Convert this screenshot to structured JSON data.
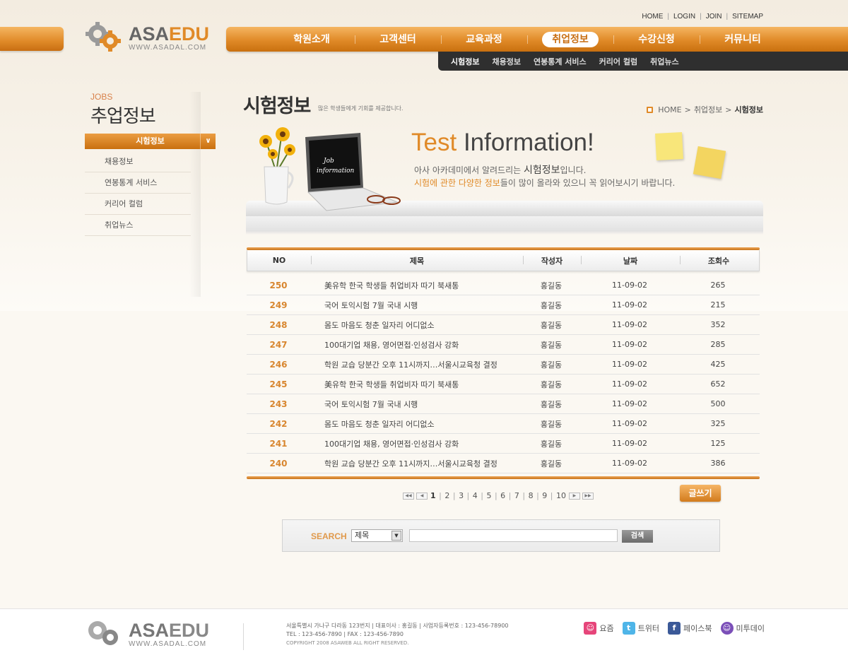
{
  "util_links": [
    "HOME",
    "LOGIN",
    "JOIN",
    "SITEMAP"
  ],
  "logo": {
    "name_gray": "ASA",
    "name_orange": "EDU",
    "url": "WWW.ASADAL.COM"
  },
  "gnb": [
    "학원소개",
    "고객센터",
    "교육과정",
    "취업정보",
    "수강신청",
    "커뮤니티"
  ],
  "sub_gnb": [
    "시험정보",
    "채용정보",
    "연봉통계 서비스",
    "커리어 컬럼",
    "취업뉴스"
  ],
  "lnb": {
    "title_en": "JOBS",
    "title": "추업정보",
    "active": "시험정보",
    "items": [
      "채용정보",
      "연봉통계 서비스",
      "커리어 컬럼",
      "취업뉴스"
    ]
  },
  "page": {
    "title": "시험정보",
    "desc": "많은 학생들에게 기회를 제공합니다.",
    "breadcrumb": [
      "HOME",
      "취업정보",
      "시험정보"
    ]
  },
  "banner": {
    "head_a": "Test",
    "head_b": "Information!",
    "line1_pre": "아사 아카데미에서 알려드리는 ",
    "line1_bold": "시험정보",
    "line1_post": "입니다.",
    "line2_bold": "시험에 관한 다양한 정보",
    "line2_post": "들이 많이 올라와 있으니 꼭 읽어보시기 바랍니다.",
    "laptop_text": "Job information"
  },
  "board": {
    "headers": {
      "no": "NO",
      "title": "제목",
      "author": "작성자",
      "date": "날짜",
      "views": "조회수"
    },
    "rows": [
      {
        "no": "250",
        "title": "美유학 한국 학생들 취업비자 따기 북새통",
        "author": "홍길동",
        "date": "11-09-02",
        "views": "265"
      },
      {
        "no": "249",
        "title": "국어 토익시험 7월 국내 시행",
        "author": "홍길동",
        "date": "11-09-02",
        "views": "215"
      },
      {
        "no": "248",
        "title": "몸도 마음도 청춘 일자리 어디없소",
        "author": "홍길동",
        "date": "11-09-02",
        "views": "352"
      },
      {
        "no": "247",
        "title": "100대기업 채용, 영어면접·인성검사 강화",
        "author": "홍길동",
        "date": "11-09-02",
        "views": "285"
      },
      {
        "no": "246",
        "title": "학원 교습 당분간 오후 11시까지…서울시교육청 결정",
        "author": "홍길동",
        "date": "11-09-02",
        "views": "425"
      },
      {
        "no": "245",
        "title": "美유학 한국 학생들 취업비자 따기 북새통",
        "author": "홍길동",
        "date": "11-09-02",
        "views": "652"
      },
      {
        "no": "243",
        "title": "국어 토익시험 7월 국내 시행",
        "author": "홍길동",
        "date": "11-09-02",
        "views": "500"
      },
      {
        "no": "242",
        "title": "몸도 마음도 청춘 일자리 어디없소",
        "author": "홍길동",
        "date": "11-09-02",
        "views": "325"
      },
      {
        "no": "241",
        "title": "100대기업 채용, 영어면접·인성검사 강화",
        "author": "홍길동",
        "date": "11-09-02",
        "views": "125"
      },
      {
        "no": "240",
        "title": "학원 교습 당분간 오후 11시까지…서울시교육청 결정",
        "author": "홍길동",
        "date": "11-09-02",
        "views": "386"
      }
    ]
  },
  "pager": {
    "pages": [
      "1",
      "2",
      "3",
      "4",
      "5",
      "6",
      "7",
      "8",
      "9",
      "10"
    ],
    "current": "1"
  },
  "write_label": "글쓰기",
  "search": {
    "label": "SEARCH",
    "select_value": "제목",
    "button": "검색"
  },
  "footer": {
    "address": "서울특별시 가나구 다라동 123번지  |  대표이사 : 홍길동  |  사업자등록번호 : 123-456-78900",
    "contact": "TEL : 123-456-7890  |  FAX : 123-456-7890",
    "copyright": "COPYRIGHT 2008 ASAWEB ALL RIGHT RESERVED.",
    "sns": [
      "요즘",
      "트위터",
      "페이스북",
      "미투데이"
    ]
  },
  "colors": {
    "accent": "#e08a28",
    "dark_nav": "#2f2f2f"
  }
}
